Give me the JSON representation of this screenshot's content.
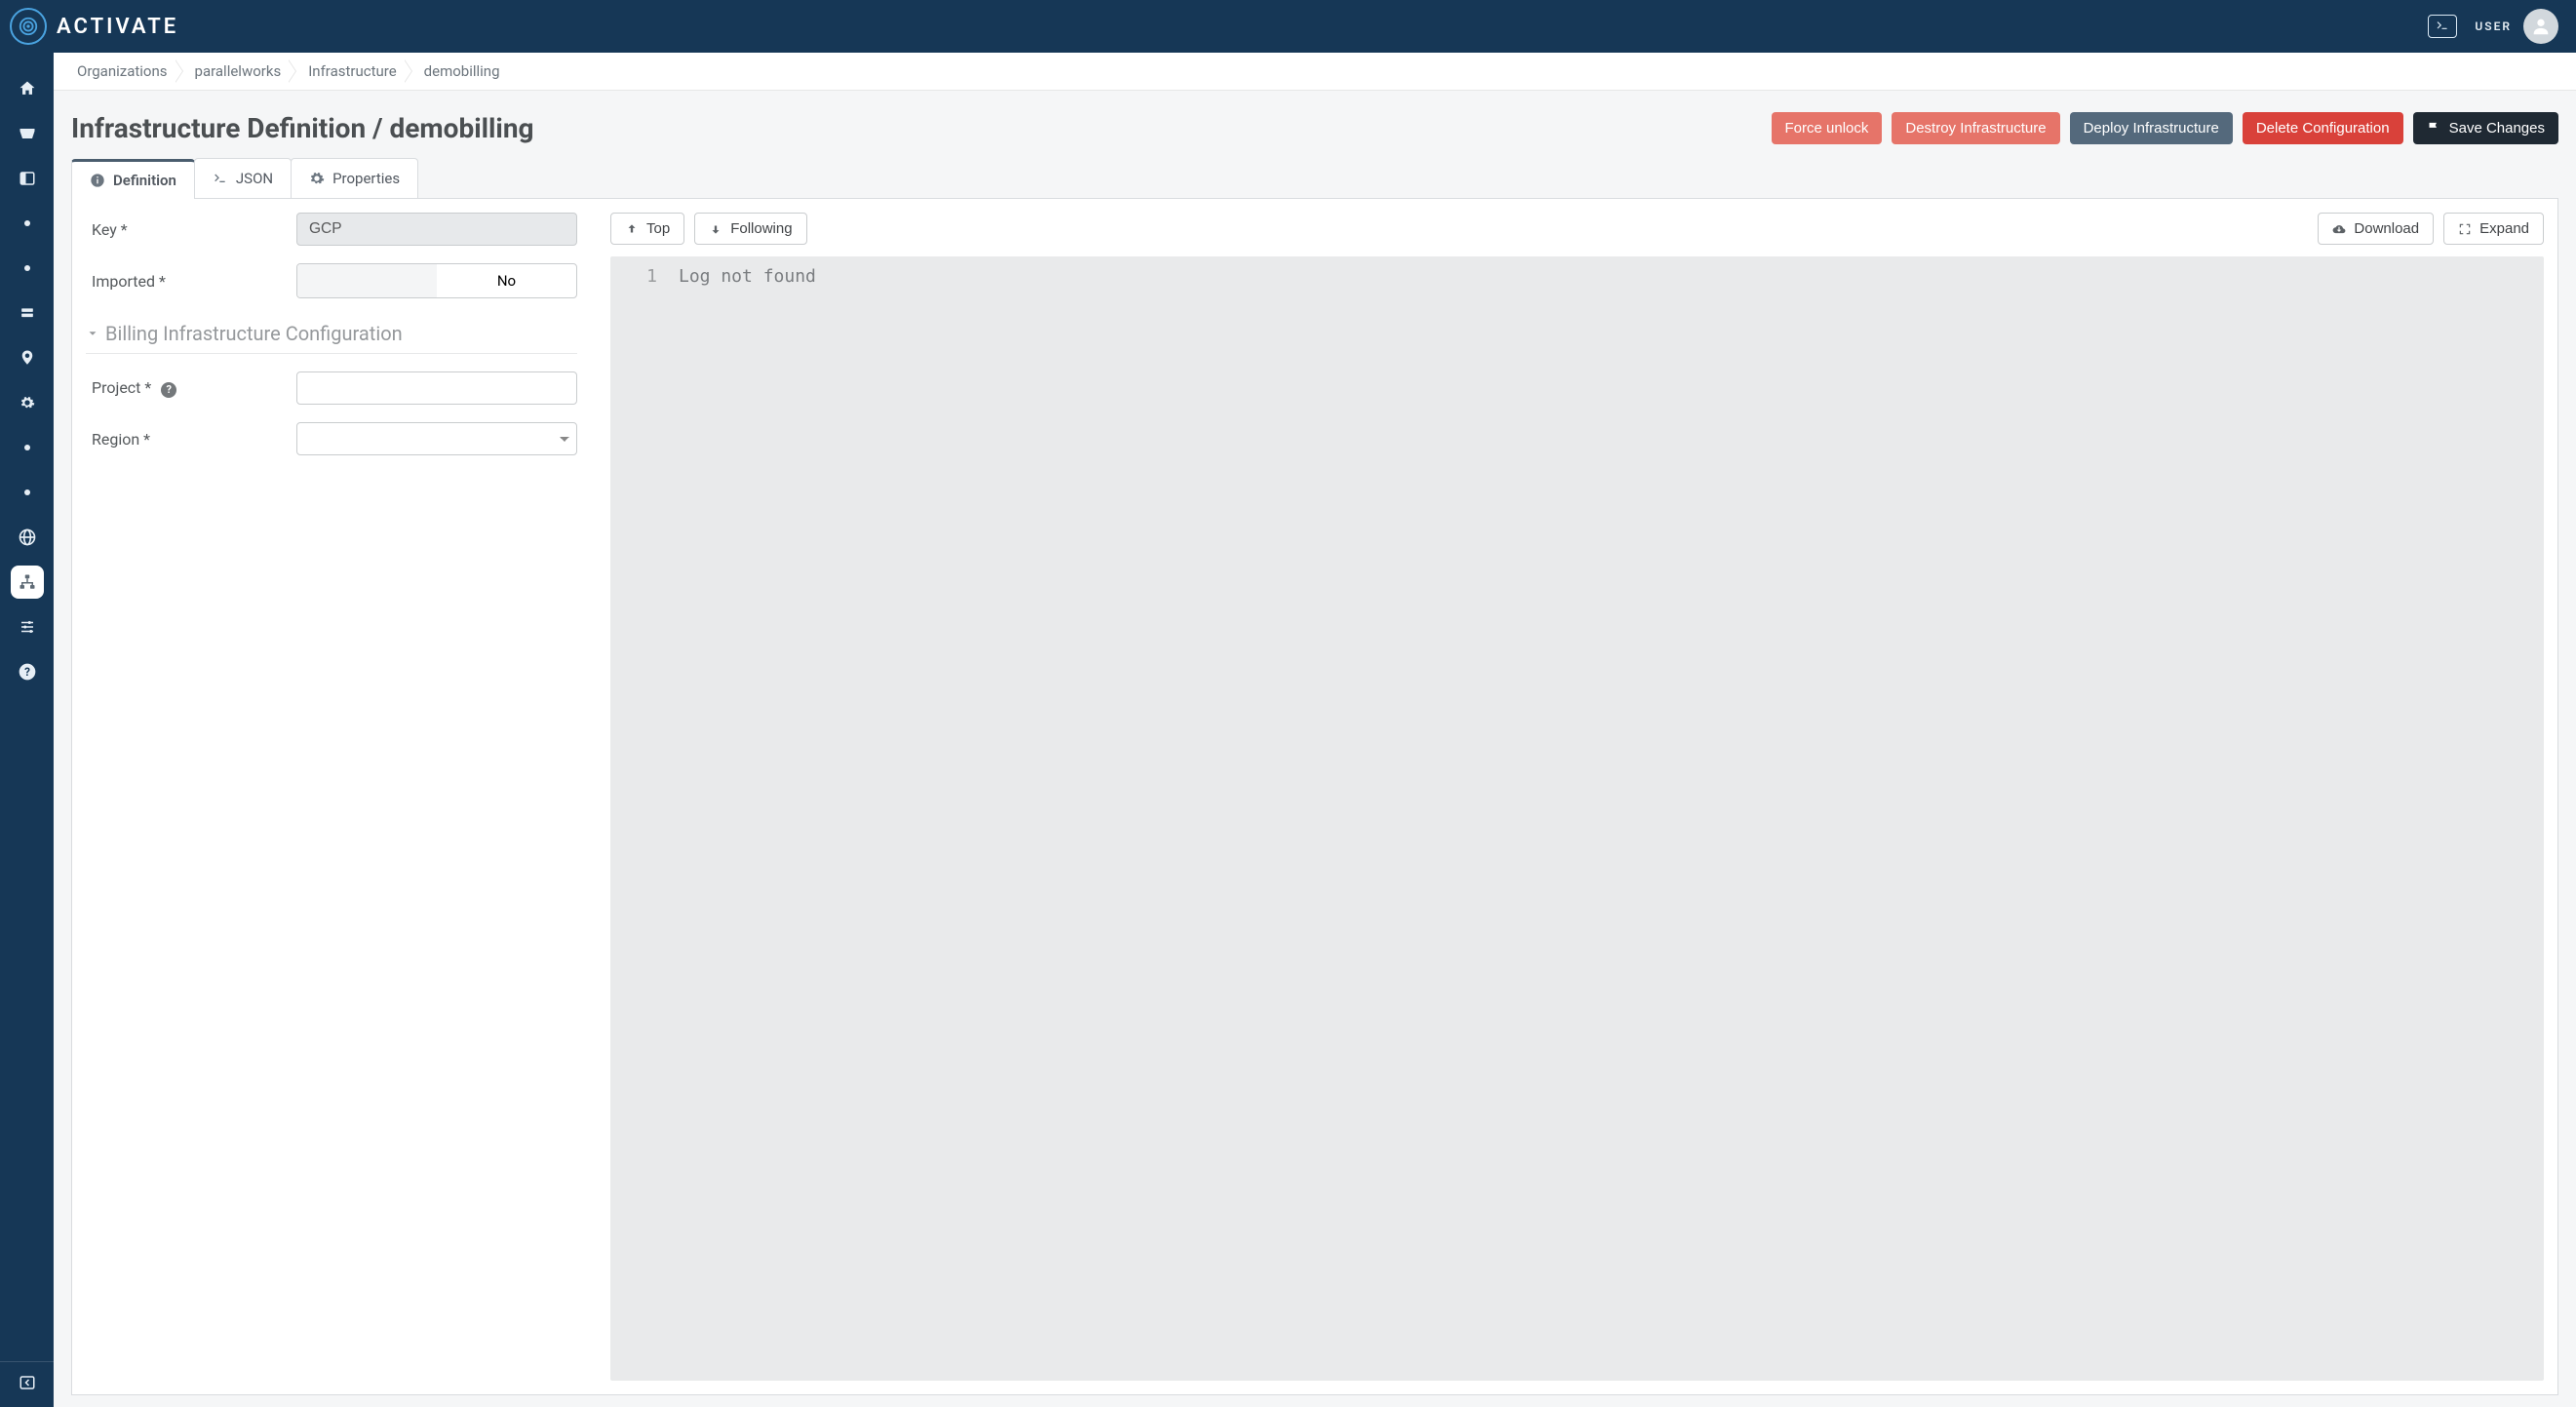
{
  "brand": {
    "name": "ACTIVATE"
  },
  "header": {
    "user_label": "USER"
  },
  "breadcrumb": [
    {
      "label": "Organizations"
    },
    {
      "label": "parallelworks"
    },
    {
      "label": "Infrastructure"
    },
    {
      "label": "demobilling"
    }
  ],
  "page": {
    "title": "Infrastructure Definition / demobilling"
  },
  "actions": {
    "force_unlock": "Force unlock",
    "destroy": "Destroy Infrastructure",
    "deploy": "Deploy Infrastructure",
    "delete_config": "Delete Configuration",
    "save": "Save Changes"
  },
  "tabs": {
    "definition": "Definition",
    "json": "JSON",
    "properties": "Properties"
  },
  "form": {
    "key_label": "Key *",
    "key_value": "GCP",
    "imported_label": "Imported *",
    "imported_no": "No",
    "section_title": "Billing Infrastructure Configuration",
    "project_label": "Project *",
    "project_value": "",
    "region_label": "Region *",
    "region_value": ""
  },
  "log": {
    "top": "Top",
    "following": "Following",
    "download": "Download",
    "expand": "Expand",
    "lines": [
      {
        "n": "1",
        "text": "Log not found"
      }
    ]
  },
  "sidebar": {
    "items": [
      {
        "name": "home-icon"
      },
      {
        "name": "inbox-icon"
      },
      {
        "name": "panel-icon"
      },
      {
        "name": "dot-1"
      },
      {
        "name": "dot-2"
      },
      {
        "name": "storage-icon"
      },
      {
        "name": "location-icon"
      },
      {
        "name": "gear-small-icon"
      },
      {
        "name": "dot-3"
      },
      {
        "name": "dot-4"
      },
      {
        "name": "globe-icon"
      },
      {
        "name": "sitemap-icon"
      },
      {
        "name": "sliders-icon"
      },
      {
        "name": "help-icon"
      }
    ]
  }
}
